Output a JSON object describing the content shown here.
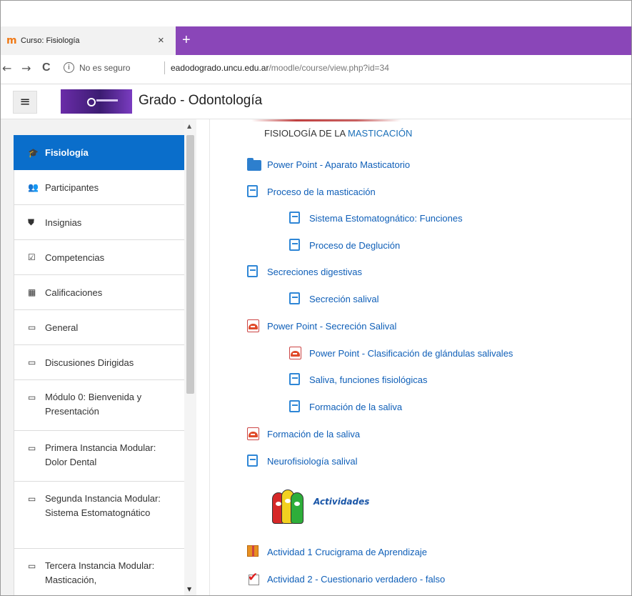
{
  "browser": {
    "tab_favicon": "m",
    "tab_title": "Curso: Fisiología",
    "tab_close": "×",
    "new_tab": "+",
    "back": "←",
    "forward": "→",
    "reload": "C",
    "info_icon": "i",
    "security_text": "No es seguro",
    "url_domain": "eadodogrado.uncu.edu.ar",
    "url_path": "/moodle/course/view.php?id=34"
  },
  "header": {
    "menu_icon": "≡",
    "site_name": "Grado - Odontología"
  },
  "sidebar": {
    "items": [
      {
        "icon": "🎓",
        "icon_name": "graduation-cap-icon",
        "label": "Fisiología"
      },
      {
        "icon": "👥",
        "icon_name": "users-icon",
        "label": "Participantes"
      },
      {
        "icon": "⛊",
        "icon_name": "shield-icon",
        "label": "Insignias"
      },
      {
        "icon": "☑",
        "icon_name": "checkbox-icon",
        "label": "Competencias"
      },
      {
        "icon": "▦",
        "icon_name": "table-icon",
        "label": "Calificaciones"
      },
      {
        "icon": "▭",
        "icon_name": "folder-icon",
        "label": "General"
      },
      {
        "icon": "▭",
        "icon_name": "folder-icon",
        "label": "Discusiones Dirigidas"
      },
      {
        "icon": "▭",
        "icon_name": "folder-icon",
        "label": "Módulo 0: Bienvenida y Presentación"
      },
      {
        "icon": "▭",
        "icon_name": "folder-icon",
        "label": "Primera Instancia Modular: Dolor Dental"
      },
      {
        "icon": "▭",
        "icon_name": "folder-icon",
        "label": "Segunda Instancia Modular: Sistema Estomatognático"
      },
      {
        "icon": "▭",
        "icon_name": "folder-icon",
        "label": "Tercera Instancia Modular: Masticación,"
      }
    ],
    "scroll_up": "▲",
    "scroll_down": "▼"
  },
  "main": {
    "section_title_prefix": "FISIOLOGÍA DE LA ",
    "section_title_highlight": "MASTICACIÓN",
    "activities": [
      {
        "type": "folder",
        "label": "Power Point - Aparato Masticatorio"
      },
      {
        "type": "page",
        "label": "Proceso de la masticación"
      },
      {
        "type": "page",
        "label": "Sistema Estomatognático: Funciones"
      },
      {
        "type": "page",
        "label": "Proceso de Deglución"
      },
      {
        "type": "page",
        "label": "Secreciones digestivas"
      },
      {
        "type": "page",
        "label": "Secreción salival"
      },
      {
        "type": "pdf",
        "label": "Power Point - Secreción Salival"
      },
      {
        "type": "pdf",
        "label": "Power Point - Clasificación de glándulas salivales"
      },
      {
        "type": "page",
        "label": "Saliva, funciones fisiológicas"
      },
      {
        "type": "page",
        "label": "Formación de la saliva"
      },
      {
        "type": "pdf",
        "label": "Formación de la saliva"
      },
      {
        "type": "page",
        "label": "Neurofisiología salival"
      }
    ],
    "activities_banner": "Actividades",
    "tasks": [
      {
        "type": "gift",
        "label": "Actividad 1 Crucigrama de Aprendizaje"
      },
      {
        "type": "quiz",
        "label": "Actividad 2 - Cuestionario verdadero - falso"
      }
    ]
  },
  "colors": {
    "tabbar": "#8a46b8",
    "active_nav": "#0a6ecb",
    "link": "#0f5fb8"
  }
}
